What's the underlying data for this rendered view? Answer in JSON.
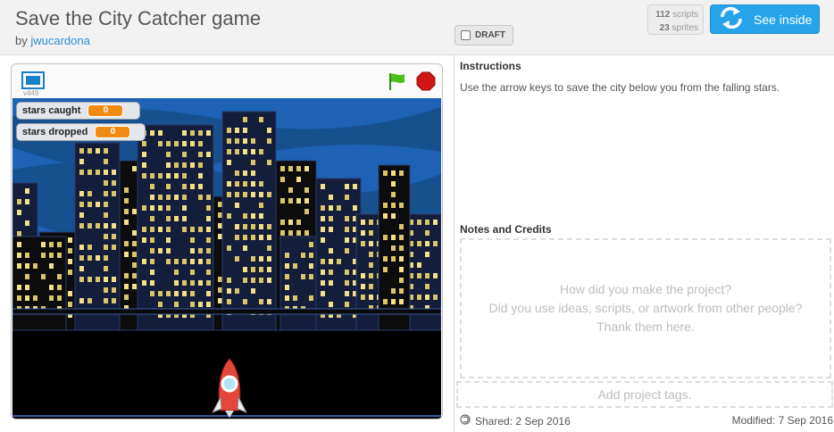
{
  "project": {
    "title": "Save the City Catcher game",
    "by_label": "by",
    "author": "jwucardona",
    "draft_label": "DRAFT",
    "scripts_count": "112",
    "scripts_label": "scripts",
    "sprites_count": "23",
    "sprites_label": "sprites",
    "see_inside_label": "See inside"
  },
  "player": {
    "version": "v449",
    "monitors": [
      {
        "label": "stars caught",
        "value": "0"
      },
      {
        "label": "stars dropped",
        "value": "0"
      }
    ]
  },
  "instructions": {
    "heading": "Instructions",
    "text": "Use the arrow keys to save the city below you from the falling stars."
  },
  "notes": {
    "heading": "Notes and Credits",
    "placeholder_line1": "How did you make the project?",
    "placeholder_line2": "Did you use ideas, scripts, or artwork from other people?",
    "placeholder_line3": "Thank them here."
  },
  "tags": {
    "placeholder": "Add project tags."
  },
  "footer": {
    "shared": "Shared: 2 Sep 2016",
    "modified": "Modified: 7 Sep 2016"
  },
  "colors": {
    "accent": "#27a3ea",
    "monitor_value": "#f08a13",
    "sky": "#1d62b4"
  }
}
